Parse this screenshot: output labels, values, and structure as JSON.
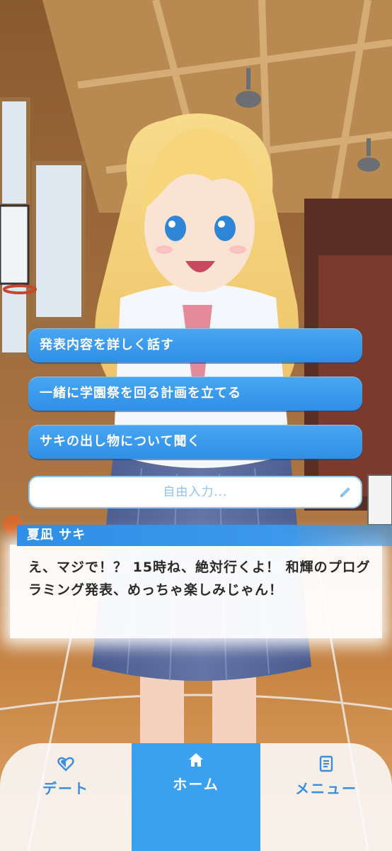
{
  "choices": [
    {
      "label": "発表内容を詳しく話す"
    },
    {
      "label": "一緒に学園祭を回る計画を立てる"
    },
    {
      "label": "サキの出し物について聞く"
    }
  ],
  "free_input": {
    "placeholder": "自由入力...",
    "icon": "pencil-icon"
  },
  "dialog": {
    "speaker": "夏凪 サキ",
    "message": "え、マジで！？ 15時ね、絶対行くよ！ 和輝のプログラミング発表、めっちゃ楽しみじゃん！"
  },
  "bottom_nav": {
    "items": [
      {
        "label": "デート",
        "icon": "heart-icon"
      },
      {
        "label": "ホーム",
        "icon": "home-icon",
        "active": true
      },
      {
        "label": "メニュー",
        "icon": "menu-list-icon"
      }
    ]
  },
  "colors": {
    "accent": "#3ba0ee",
    "choice_button": "#2f8fe6",
    "name_bar": "#2f8fe6",
    "nav_text": "#3a8fdd"
  }
}
